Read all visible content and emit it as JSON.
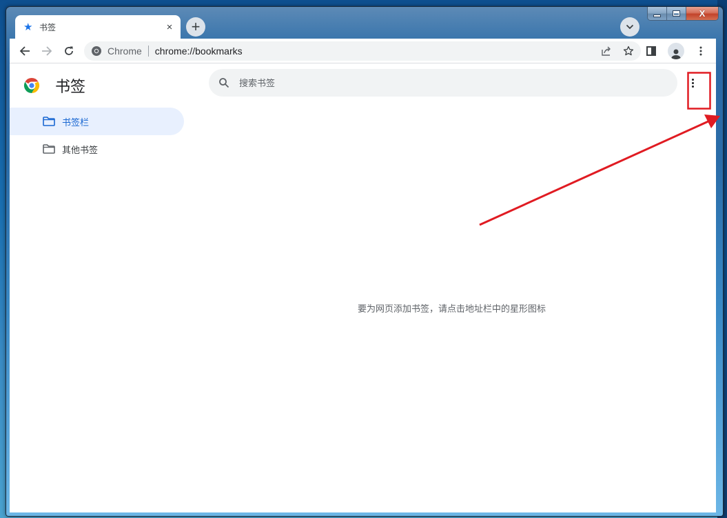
{
  "window": {
    "controls": {
      "minimize": "minimize",
      "maximize": "maximize",
      "close": "close"
    }
  },
  "tab": {
    "title": "书签",
    "icon": "star-icon",
    "close_label": "×"
  },
  "new_tab_label": "+",
  "toolbar": {
    "omnibox_site": "Chrome",
    "omnibox_url": "chrome://bookmarks"
  },
  "page": {
    "title": "书签",
    "search_placeholder": "搜索书签",
    "sidebar": [
      {
        "label": "书签栏",
        "selected": true
      },
      {
        "label": "其他书签",
        "selected": false
      }
    ],
    "empty_message": "要为网页添加书签，请点击地址栏中的星形图标"
  },
  "annotation": {
    "color": "#e01b22",
    "highlight_target": "more-options-button"
  }
}
